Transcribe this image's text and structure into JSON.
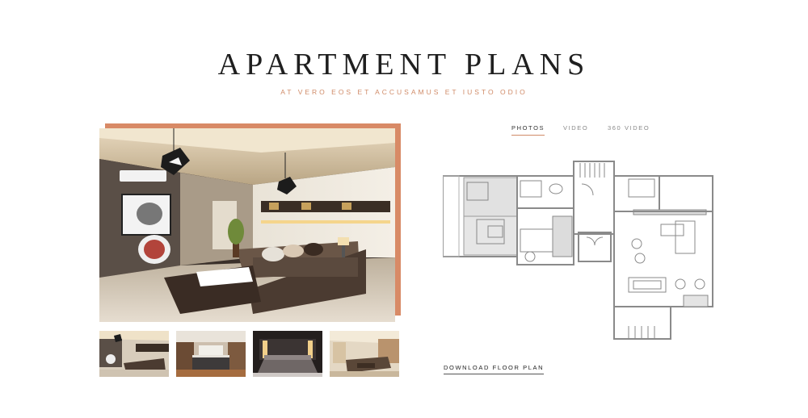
{
  "header": {
    "title": "APARTMENT PLANS",
    "subtitle": "AT VERO EOS ET ACCUSAMUS ET IUSTO ODIO"
  },
  "gallery": {
    "main_image": "living-room-photo",
    "thumbnails": [
      "living-room-photo",
      "kitchen-photo",
      "bedroom-photo",
      "lounge-photo"
    ]
  },
  "tabs": [
    {
      "label": "PHOTOS",
      "active": true
    },
    {
      "label": "VIDEO",
      "active": false
    },
    {
      "label": "360 VIDEO",
      "active": false
    }
  ],
  "floorplan": {
    "image": "floor-plan-drawing"
  },
  "download": {
    "label": "DOWNLOAD FLOOR PLAN"
  },
  "colors": {
    "accent": "#d88a66",
    "title": "#1f1f1f",
    "subtitle": "#d08b68"
  }
}
